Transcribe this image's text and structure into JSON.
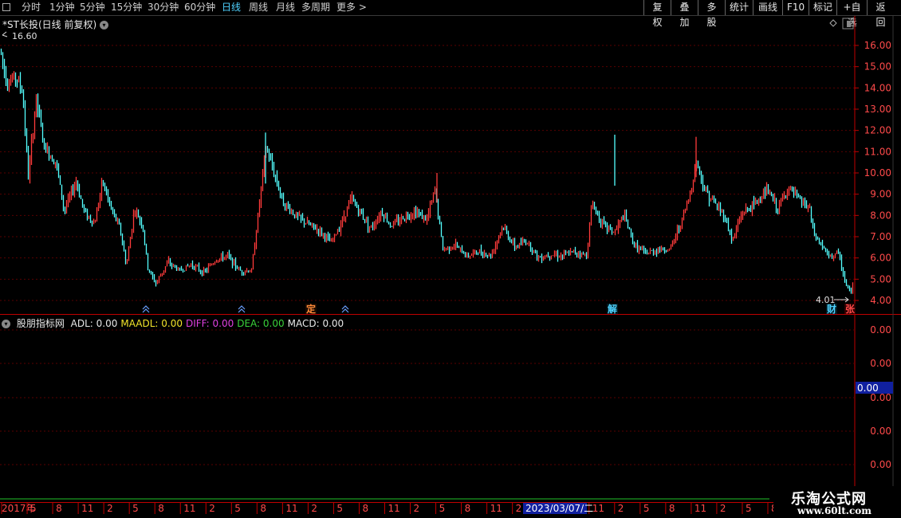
{
  "toolbar": {
    "periods": [
      "分时",
      "1分钟",
      "5分钟",
      "15分钟",
      "30分钟",
      "60分钟",
      "日线",
      "周线",
      "月线",
      "多周期",
      "更多 >"
    ],
    "active_period": "日线",
    "right_buttons": [
      "复权",
      "叠加",
      "多股",
      "统计",
      "画线",
      "F10",
      "标记",
      "+自选",
      "返回"
    ]
  },
  "chart": {
    "title": "*ST长投(日线 前复权)",
    "high_label": "16.60",
    "low_label": "4.01",
    "y_ticks": [
      "16.00",
      "15.00",
      "14.00",
      "13.00",
      "12.00",
      "11.00",
      "10.00",
      "9.00",
      "8.00",
      "7.00",
      "6.00",
      "5.00",
      "4.00"
    ],
    "markers": [
      {
        "text": "定",
        "color": "#ff8a3a"
      },
      {
        "text": "解",
        "color": "#4fd2ff"
      },
      {
        "text": "财",
        "color": "#4fd2ff"
      },
      {
        "text": "张",
        "color": "#ff4a4a"
      }
    ]
  },
  "indicator": {
    "name": "股朋指标网",
    "items": [
      {
        "label": "ADL: 0.00",
        "color": "#e8e8e8"
      },
      {
        "label": "MAADL: 0.00",
        "color": "#f2e32a"
      },
      {
        "label": "DIFF: 0.00",
        "color": "#e040e0"
      },
      {
        "label": "DEA: 0.00",
        "color": "#3ad23a"
      },
      {
        "label": "MACD: 0.00",
        "color": "#e8e8e8"
      }
    ],
    "y_ticks": [
      "0.00",
      "0.00",
      "0.00",
      "0.00",
      "0.00"
    ],
    "current_value": "0.00"
  },
  "time_axis": {
    "labels": [
      "2017年",
      "5",
      "8",
      "11",
      "2",
      "5",
      "8",
      "11",
      "2",
      "5",
      "8",
      "11",
      "2",
      "5",
      "8",
      "11",
      "2",
      "5",
      "8",
      "11",
      "2",
      "5",
      "8",
      "11",
      "2",
      "5",
      "8",
      "11",
      "2",
      "5",
      "8"
    ],
    "cursor_label": "2023/03/07/二"
  },
  "watermark": {
    "line1": "乐淘公式网",
    "line2": "www.60lt.com"
  },
  "colors": {
    "up": "#ff3b3b",
    "down": "#54ffff",
    "grid": "#5a0000",
    "axis": "#c00000"
  }
}
